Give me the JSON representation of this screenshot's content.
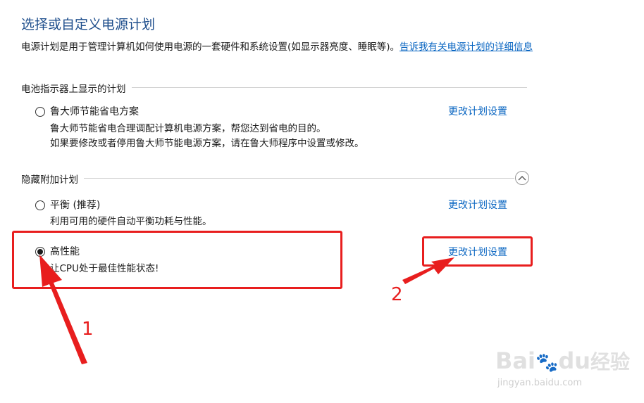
{
  "header": {
    "title": "选择或自定义电源计划",
    "description": "电源计划是用于管理计算机如何使用电源的一套硬件和系统设置(如显示器亮度、睡眠等)。",
    "learn_more_link": "告诉我有关电源计划的详细信息"
  },
  "battery_section": {
    "label": "电池指示器上显示的计划",
    "plans": [
      {
        "name": "鲁大师节能省电方案",
        "desc_lines": [
          "鲁大师节能省电合理调配计算机电源方案，帮您达到省电的目的。",
          "如果要修改或者停用鲁大师节能电源方案，请在鲁大师程序中设置或修改。"
        ],
        "link": "更改计划设置",
        "selected": false
      }
    ]
  },
  "hidden_section": {
    "label": "隐藏附加计划",
    "plans": [
      {
        "name": "平衡 (推荐)",
        "desc": "利用可用的硬件自动平衡功耗与性能。",
        "link": "更改计划设置",
        "selected": false
      },
      {
        "name": "高性能",
        "desc": "让CPU处于最佳性能状态!",
        "link": "更改计划设置",
        "selected": true
      }
    ]
  },
  "annotations": {
    "label_1": "1",
    "label_2": "2",
    "color": "#e81e1e"
  },
  "watermark": {
    "brand_left": "Bai",
    "brand_right": "du",
    "brand_cn": "经验",
    "url": "jingyan.baidu.com"
  }
}
